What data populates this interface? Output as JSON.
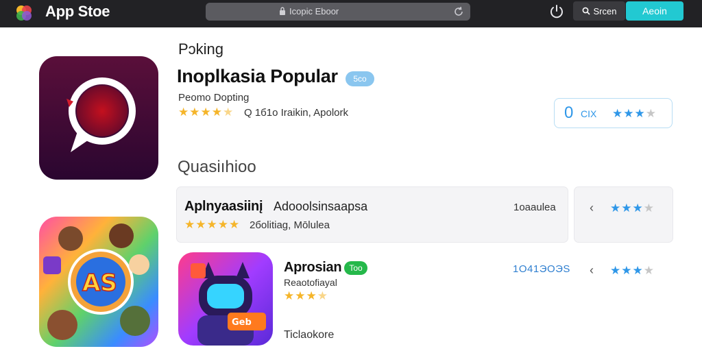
{
  "topbar": {
    "app_title": "App Stoe",
    "address_text": "Icopic Eboor",
    "search_label": "Srcen",
    "action_label": "Aeoin"
  },
  "hero": {
    "section_label": "Pɔking",
    "headline": "Inoplkasia Popular",
    "badge": "5co",
    "subtitle": "Peomo Dopting",
    "meta": "Q 1б1o Iraikin,   Apolork",
    "rating_value": "0",
    "rating_unit": "CIX",
    "rating_stars": 3,
    "app_stars": 4.5
  },
  "question_label": "Quasiıhioo",
  "rows": [
    {
      "title": "Aplnyaasiinį",
      "description": "Adooolsinsaapsa",
      "size": "1oaaulea",
      "meta": "2бolitiag,   Mōlulea",
      "stars": 5,
      "side_stars": 3,
      "side_chevron": "‹"
    },
    {
      "title": "Aprosian",
      "badge": "Too",
      "subtitle": "Reaotofiayal",
      "size": "1O41ЭOЭS",
      "footer": "Ticlaokore",
      "stars": 3.5,
      "side_stars": 3,
      "side_chevron": "‹"
    }
  ],
  "icons": {
    "logo": "app-store-logo-icon",
    "lock": "lock-icon",
    "reload": "reload-icon",
    "power": "power-icon",
    "search": "search-icon",
    "hero_app": "chat-bubble-app-icon",
    "game_app": "game-characters-app-icon",
    "robot_app": "robot-app-icon"
  },
  "colors": {
    "topbar_bg": "#222225",
    "accent_cyan": "#22c9d2",
    "star_gold": "#f5b52a",
    "star_blue": "#2f97e8",
    "badge_blue": "#8ac6ef",
    "badge_green": "#25b84a"
  }
}
